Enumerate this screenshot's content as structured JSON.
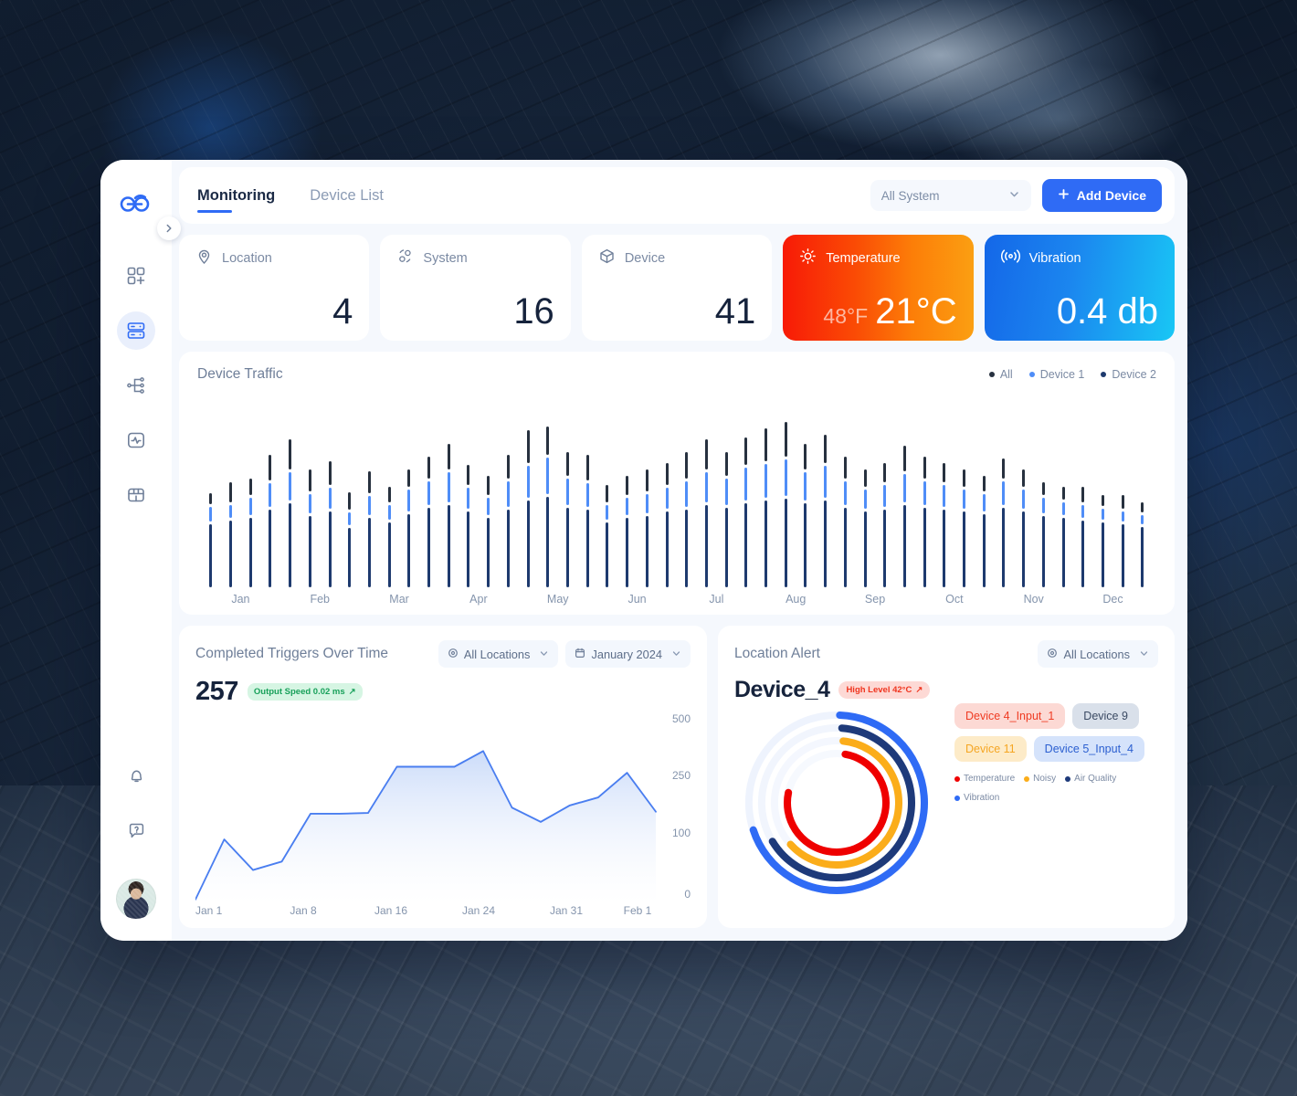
{
  "app": {
    "tabs": [
      {
        "label": "Monitoring",
        "active": true
      },
      {
        "label": "Device List",
        "active": false
      }
    ],
    "system_select": "All System",
    "add_device_label": "Add Device",
    "add_icon": "plus-icon"
  },
  "sidebar": {
    "logo_icon": "cloud-logo-icon",
    "toggle_icon": "chevron-right-icon",
    "items": [
      {
        "icon": "grid-plus-icon",
        "name": "dashboard",
        "active": false
      },
      {
        "icon": "server-stack-icon",
        "name": "devices",
        "active": true
      },
      {
        "icon": "network-nodes-icon",
        "name": "topology",
        "active": false
      },
      {
        "icon": "activity-monitor-icon",
        "name": "analytics",
        "active": false
      },
      {
        "icon": "storage-icon",
        "name": "storage",
        "active": false
      }
    ],
    "bottom_items": [
      {
        "icon": "bell-icon",
        "name": "notifications"
      },
      {
        "icon": "help-bubble-icon",
        "name": "help"
      }
    ],
    "avatar_name": "user-avatar"
  },
  "stats": [
    {
      "label": "Location",
      "value": "4",
      "icon": "location-pin-icon",
      "theme": "plain"
    },
    {
      "label": "System",
      "value": "16",
      "icon": "system-nodes-icon",
      "theme": "plain"
    },
    {
      "label": "Device",
      "value": "41",
      "icon": "cube-icon",
      "theme": "plain"
    },
    {
      "label": "Temperature",
      "value": "21°C",
      "secondary": "48°F",
      "icon": "sun-icon",
      "theme": "temp",
      "color_from": "#f81a06",
      "color_to": "#fb9f12"
    },
    {
      "label": "Vibration",
      "value": "0.4 db",
      "icon": "vibration-waves-icon",
      "theme": "vib",
      "color_from": "#1467e8",
      "color_to": "#19c7f5"
    }
  ],
  "traffic": {
    "title": "Device Traffic",
    "legend": [
      {
        "label": "All",
        "color": "#27313f"
      },
      {
        "label": "Device 1",
        "color": "#4f8df7"
      },
      {
        "label": "Device 2",
        "color": "#1e3a6e"
      }
    ]
  },
  "triggers": {
    "title": "Completed Triggers Over Time",
    "location_filter": "All Locations",
    "location_icon": "location-target-icon",
    "date_filter": "January 2024",
    "date_icon": "calendar-icon",
    "value": "257",
    "badge": "Output Speed 0.02 ms",
    "badge_arrow": "↗",
    "badge_color": "#18a05a"
  },
  "alert": {
    "title": "Location Alert",
    "location_filter": "All Locations",
    "location_icon": "location-target-icon",
    "device": "Device_4",
    "badge": "High Level 42°C",
    "badge_arrow": "↗",
    "badge_color": "#f0351f",
    "tags": [
      [
        {
          "label": "Device 4_Input_1",
          "cls": "t-red"
        },
        {
          "label": "Device 9",
          "cls": "t-gray"
        }
      ],
      [
        {
          "label": "Device 11",
          "cls": "t-orange"
        },
        {
          "label": "Device 5_Input_4",
          "cls": "t-blue"
        }
      ]
    ],
    "legend": [
      {
        "label": "Temperature",
        "color": "#ef0000"
      },
      {
        "label": "Noisy",
        "color": "#fbad1a"
      },
      {
        "label": "Air Quality",
        "color": "#1e3a7a"
      },
      {
        "label": "Vibration",
        "color": "#2f6bf5"
      }
    ]
  },
  "chart_data": [
    {
      "type": "bar",
      "name": "device-traffic",
      "title": "Device Traffic",
      "stacked": true,
      "categories": [
        "Jan",
        "Feb",
        "Mar",
        "Apr",
        "May",
        "Jun",
        "Jul",
        "Aug",
        "Sep",
        "Oct",
        "Nov",
        "Dec"
      ],
      "bars_per_category": 4,
      "series": [
        {
          "name": "Device 2",
          "color": "#1e3a6e",
          "values": [
            58,
            62,
            64,
            72,
            78,
            66,
            70,
            55,
            64,
            60,
            68,
            74,
            76,
            70,
            64,
            72,
            80,
            84,
            74,
            72,
            60,
            64,
            66,
            70,
            72,
            76,
            74,
            78,
            80,
            82,
            78,
            80,
            74,
            70,
            72,
            76,
            74,
            72,
            70,
            68,
            74,
            70,
            66,
            64,
            62,
            60,
            58,
            56
          ]
        },
        {
          "name": "Device 1",
          "color": "#4f8df7",
          "values": [
            14,
            12,
            16,
            22,
            26,
            18,
            20,
            12,
            18,
            14,
            20,
            22,
            28,
            20,
            16,
            24,
            30,
            34,
            24,
            22,
            14,
            16,
            18,
            20,
            24,
            28,
            24,
            30,
            32,
            34,
            26,
            30,
            22,
            18,
            20,
            26,
            22,
            20,
            18,
            16,
            22,
            18,
            14,
            12,
            12,
            10,
            10,
            8
          ]
        },
        {
          "name": "All",
          "color": "#27313f",
          "values": [
            10,
            18,
            16,
            24,
            28,
            20,
            22,
            16,
            20,
            14,
            16,
            20,
            24,
            18,
            18,
            22,
            30,
            26,
            22,
            24,
            16,
            18,
            20,
            20,
            24,
            28,
            22,
            26,
            30,
            32,
            24,
            26,
            20,
            16,
            18,
            24,
            20,
            18,
            16,
            14,
            18,
            16,
            12,
            12,
            14,
            10,
            12,
            10
          ]
        }
      ],
      "xlabel": "",
      "ylabel": "",
      "grid": false,
      "legend_position": "top-right"
    },
    {
      "type": "area",
      "name": "completed-triggers-over-time",
      "title": "Completed Triggers Over Time",
      "line_color": "#4a7ef0",
      "fill_from": "#cddcfa",
      "fill_to": "#ffffff",
      "x_ticks": [
        "Jan 1",
        "Jan 8",
        "Jan 16",
        "Jan 24",
        "Jan 31",
        "Feb 1"
      ],
      "y_ticks": [
        "500",
        "250",
        "100",
        "0"
      ],
      "ylim": [
        0,
        500
      ],
      "x": [
        0,
        1,
        2,
        3,
        4,
        5,
        6,
        7,
        8,
        9,
        10,
        11,
        12,
        13,
        14,
        15,
        16
      ],
      "values": [
        0,
        92,
        45,
        58,
        150,
        150,
        152,
        275,
        275,
        275,
        340,
        165,
        130,
        170,
        190,
        250,
        155
      ],
      "grid": false
    },
    {
      "type": "pie",
      "name": "location-alert-radial",
      "title": "Location Alert – Device_4",
      "style": "concentric-arcs",
      "arcs": [
        {
          "name": "Vibration",
          "color": "#2f6bf5",
          "radius": 96,
          "sweep_deg": 250,
          "start_deg": -88,
          "track": "#eef3fd"
        },
        {
          "name": "Air Quality",
          "color": "#1e3a7a",
          "radius": 82,
          "sweep_deg": 235,
          "start_deg": -86,
          "track": "#f1f5fd"
        },
        {
          "name": "Noisy",
          "color": "#fbad1a",
          "radius": 68,
          "sweep_deg": 222,
          "start_deg": -84,
          "track": "#f4f7fe"
        },
        {
          "name": "Temperature",
          "color": "#ef0000",
          "radius": 54,
          "sweep_deg": 272,
          "start_deg": -80,
          "track": "#f6f9fe"
        }
      ]
    }
  ]
}
